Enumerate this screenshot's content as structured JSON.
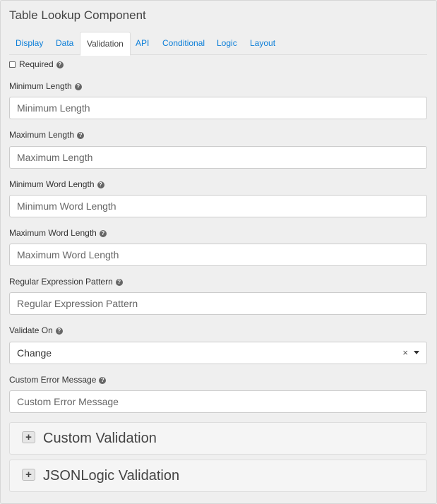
{
  "title": "Table Lookup Component",
  "tabs": [
    {
      "label": "Display",
      "active": false
    },
    {
      "label": "Data",
      "active": false
    },
    {
      "label": "Validation",
      "active": true
    },
    {
      "label": "API",
      "active": false
    },
    {
      "label": "Conditional",
      "active": false
    },
    {
      "label": "Logic",
      "active": false
    },
    {
      "label": "Layout",
      "active": false
    }
  ],
  "help_glyph": "?",
  "required": {
    "label": "Required",
    "checked": false
  },
  "fields": [
    {
      "label": "Minimum Length",
      "placeholder": "Minimum Length"
    },
    {
      "label": "Maximum Length",
      "placeholder": "Maximum Length"
    },
    {
      "label": "Minimum Word Length",
      "placeholder": "Minimum Word Length"
    },
    {
      "label": "Maximum Word Length",
      "placeholder": "Maximum Word Length"
    },
    {
      "label": "Regular Expression Pattern",
      "placeholder": "Regular Expression Pattern"
    }
  ],
  "validate_on": {
    "label": "Validate On",
    "value": "Change",
    "clear_glyph": "×"
  },
  "custom_error": {
    "label": "Custom Error Message",
    "placeholder": "Custom Error Message"
  },
  "panels": [
    {
      "title": "Custom Validation",
      "toggle_glyph": "+"
    },
    {
      "title": "JSONLogic Validation",
      "toggle_glyph": "+"
    }
  ],
  "colors": {
    "link": "#0b7ed8",
    "background": "#efefef"
  }
}
